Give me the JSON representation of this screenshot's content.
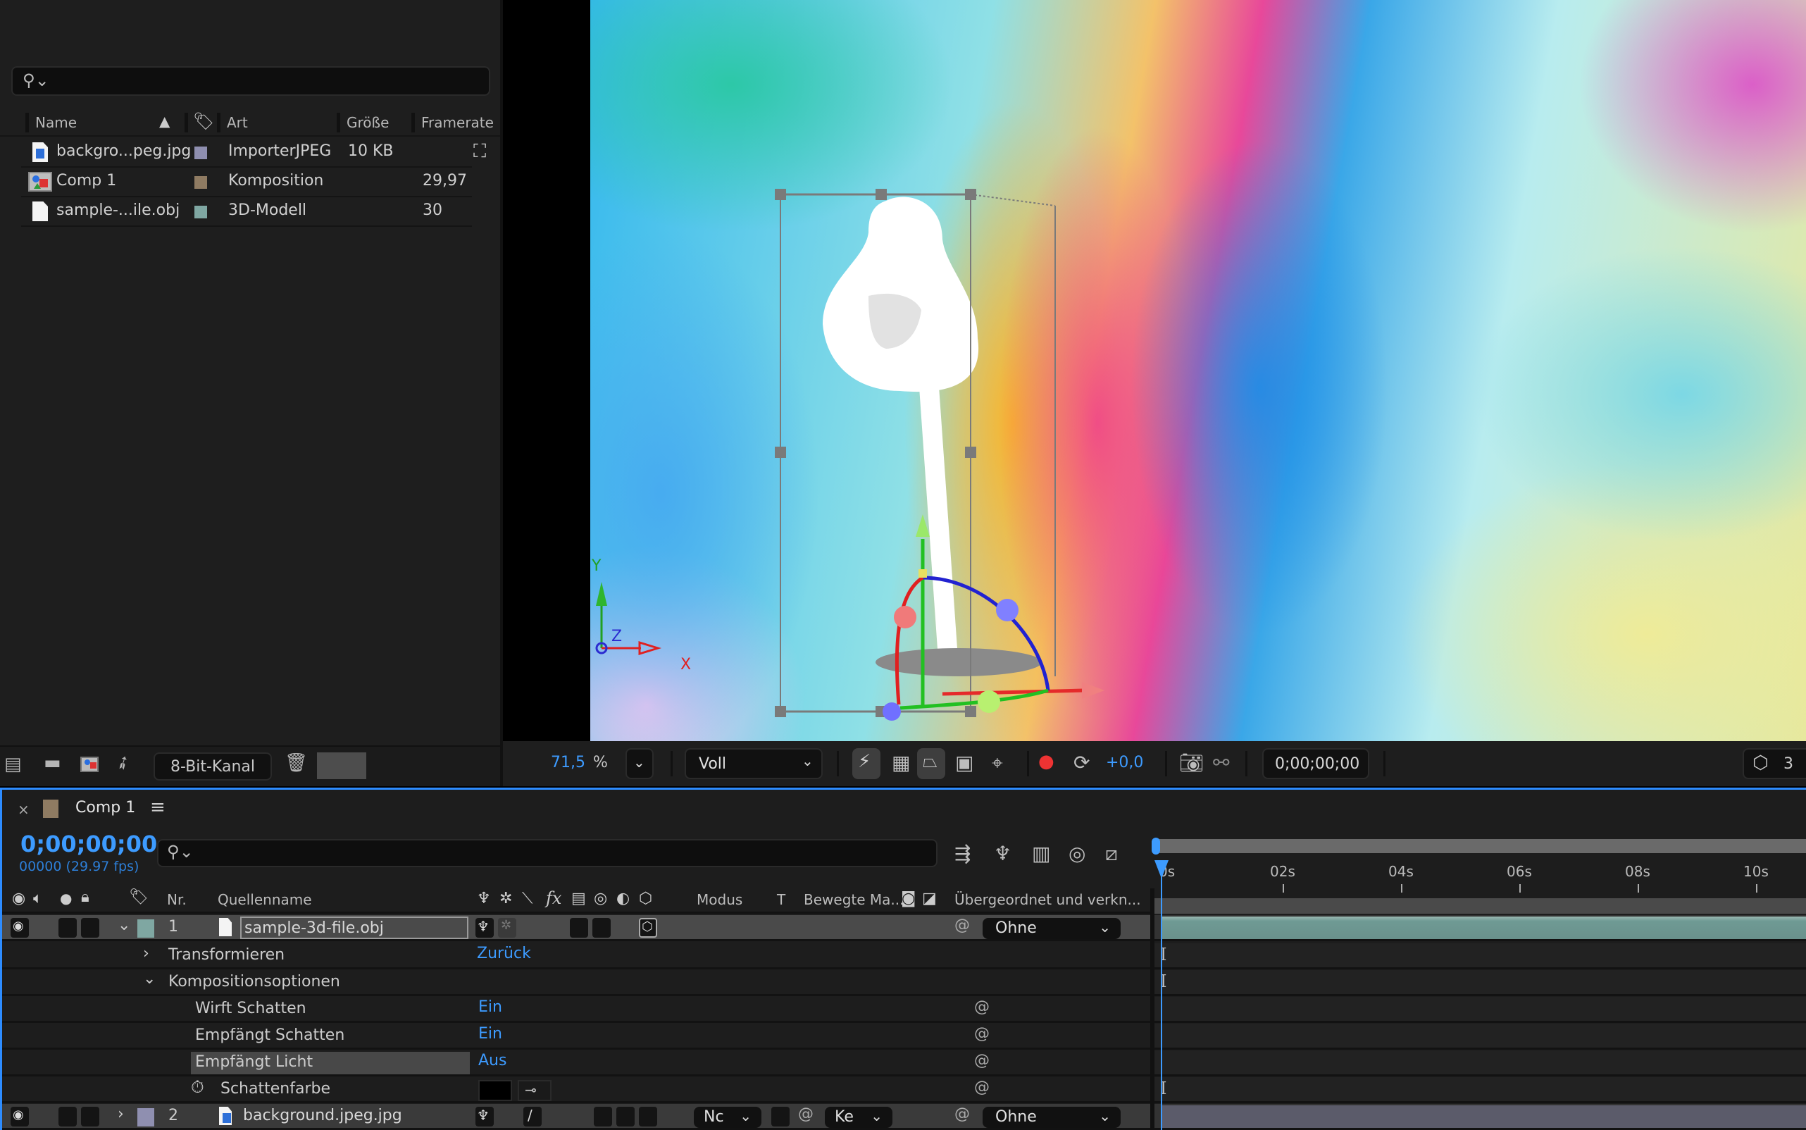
{
  "project_panel": {
    "search": {
      "placeholder": "",
      "icon": "search-dropdown-icon"
    },
    "columns": {
      "name": "Name",
      "label": "label-tag-icon",
      "type": "Art",
      "size": "Größe",
      "framerate": "Framerate"
    },
    "items": [
      {
        "icon": "jpeg-file-icon",
        "name": "backgro...peg.jpg",
        "label_color": "#8f8fb0",
        "type": "ImporterJPEG",
        "size": "10 KB",
        "framerate": "",
        "extra_icon": "flowchart-icon"
      },
      {
        "icon": "composition-icon",
        "name": "Comp 1",
        "label_color": "#8f7b62",
        "type": "Komposition",
        "size": "",
        "framerate": "29,97"
      },
      {
        "icon": "file-icon",
        "name": "sample-...ile.obj",
        "label_color": "#7fa7a2",
        "type": "3D-Modell",
        "size": "",
        "framerate": "30"
      }
    ],
    "bottom_bar": {
      "interpret_footage_icon": "interpret-footage-icon",
      "new_folder_icon": "folder-icon",
      "new_comp_icon": "new-composition-icon",
      "render_icon": "rocket-icon",
      "bit_depth": "8-Bit-Kanal",
      "delete_icon": "trash-icon"
    }
  },
  "viewer": {
    "axis_labels": {
      "x": "X",
      "y": "Y",
      "z": "Z"
    },
    "toolbar": {
      "zoom": "71,5",
      "zoom_unit": "%",
      "resolution": "Voll",
      "exposure": "+0,0",
      "timecode": "0;00;00;00",
      "renderer_label": "3"
    }
  },
  "timeline": {
    "tab_title": "Comp 1",
    "tab_color": "#8f7b62",
    "current_time": "0;00;00;00",
    "frame_info": "00000 (29.97 fps)",
    "search": {
      "placeholder": ""
    },
    "ruler": [
      "0s",
      "02s",
      "04s",
      "06s",
      "08s",
      "10s"
    ],
    "headers": {
      "nr": "Nr.",
      "source_name": "Quellenname",
      "mode": "Modus",
      "t": "T",
      "track_matte": "Bewegte Ma...",
      "parent": "Übergeordnet und verkn..."
    },
    "layers": [
      {
        "nr": "1",
        "name": "sample-3d-file.obj",
        "label_color": "#7fa7a2",
        "parent": "Ohne",
        "expanded": true
      },
      {
        "nr": "2",
        "name": "background.jpeg.jpg",
        "label_color": "#8f8fb0",
        "mode": "Nc",
        "track_matte": "Ke",
        "parent": "Ohne",
        "expanded": false
      }
    ],
    "properties": {
      "transform": {
        "label": "Transformieren",
        "value": "Zurück"
      },
      "composition_options": {
        "label": "Kompositionsoptionen"
      },
      "casts_shadows": {
        "label": "Wirft Schatten",
        "value": "Ein"
      },
      "accepts_shadows": {
        "label": "Empfängt Schatten",
        "value": "Ein"
      },
      "accepts_lights": {
        "label": "Empfängt Licht",
        "value": "Aus"
      },
      "shadow_color": {
        "label": "Schattenfarbe",
        "value": "#000000"
      }
    }
  }
}
